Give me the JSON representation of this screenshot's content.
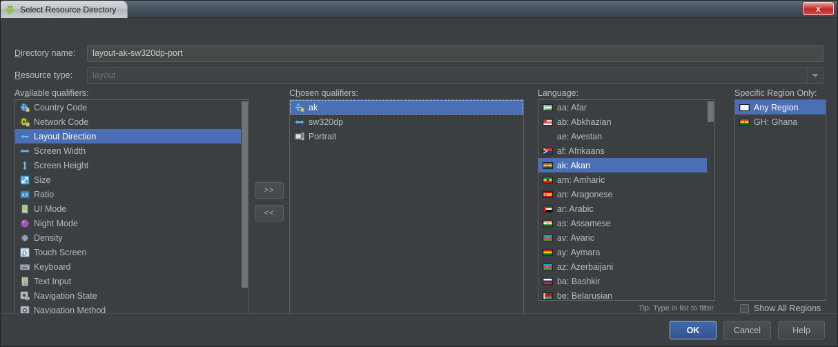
{
  "window": {
    "title": "Select Resource Directory",
    "app_icon": "android-robot-icon",
    "close_label": "x"
  },
  "form": {
    "directory_name": {
      "label": "Directory name:",
      "label_mnemonic": "D",
      "value": "layout-ak-sw320dp-port"
    },
    "resource_type": {
      "label": "Resource type:",
      "label_mnemonic": "R",
      "value": "layout",
      "disabled": true
    }
  },
  "available_qualifiers": {
    "label": "Available qualifiers:",
    "label_mnemonic": "a",
    "items": [
      {
        "label": "Country Code",
        "icon": "globe-icon",
        "selected": false
      },
      {
        "label": "Network Code",
        "icon": "network-icon",
        "selected": false
      },
      {
        "label": "Layout Direction",
        "icon": "arrow-left-icon",
        "selected": true
      },
      {
        "label": "Screen Width",
        "icon": "arrow-horizontal-icon",
        "selected": false
      },
      {
        "label": "Screen Height",
        "icon": "arrow-vertical-icon",
        "selected": false
      },
      {
        "label": "Size",
        "icon": "diagonal-arrow-icon",
        "selected": false
      },
      {
        "label": "Ratio",
        "icon": "ratio-icon",
        "selected": false
      },
      {
        "label": "UI Mode",
        "icon": "ui-mode-icon",
        "selected": false
      },
      {
        "label": "Night Mode",
        "icon": "moon-icon",
        "selected": false
      },
      {
        "label": "Density",
        "icon": "density-icon",
        "selected": false
      },
      {
        "label": "Touch Screen",
        "icon": "hand-pointer-icon",
        "selected": false
      },
      {
        "label": "Keyboard",
        "icon": "keyboard-icon",
        "selected": false
      },
      {
        "label": "Text Input",
        "icon": "text-input-icon",
        "selected": false
      },
      {
        "label": "Navigation State",
        "icon": "navigation-state-icon",
        "selected": false
      },
      {
        "label": "Navigation Method",
        "icon": "navigation-method-icon",
        "selected": false
      }
    ]
  },
  "transfer": {
    "add_label": ">>",
    "remove_label": "<<"
  },
  "chosen_qualifiers": {
    "label": "Chosen qualifiers:",
    "label_mnemonic": "h",
    "items": [
      {
        "label": "ak",
        "icon": "globe-icon",
        "selected": true
      },
      {
        "label": "sw320dp",
        "icon": "arrow-horizontal-icon",
        "selected": false
      },
      {
        "label": "Portrait",
        "icon": "portrait-icon",
        "selected": false
      }
    ]
  },
  "language": {
    "label": "Language:",
    "tip": "Tip: Type in list to filter",
    "items": [
      {
        "label": "aa: Afar",
        "flag": "flag-afar",
        "selected": false
      },
      {
        "label": "ab: Abkhazian",
        "flag": "flag-abkhazia",
        "selected": false
      },
      {
        "label": "ae: Avestan",
        "flag": "flag-none",
        "selected": false
      },
      {
        "label": "af: Afrikaans",
        "flag": "flag-south-africa",
        "selected": false
      },
      {
        "label": "ak: Akan",
        "flag": "flag-ghana",
        "selected": true
      },
      {
        "label": "am: Amharic",
        "flag": "flag-ethiopia",
        "selected": false
      },
      {
        "label": "an: Aragonese",
        "flag": "flag-spain",
        "selected": false
      },
      {
        "label": "ar: Arabic",
        "flag": "flag-uae",
        "selected": false
      },
      {
        "label": "as: Assamese",
        "flag": "flag-india",
        "selected": false
      },
      {
        "label": "av: Avaric",
        "flag": "flag-azerbaijan",
        "selected": false
      },
      {
        "label": "ay: Aymara",
        "flag": "flag-bolivia",
        "selected": false
      },
      {
        "label": "az: Azerbaijani",
        "flag": "flag-azerbaijan",
        "selected": false
      },
      {
        "label": "ba: Bashkir",
        "flag": "flag-russia",
        "selected": false
      },
      {
        "label": "be: Belarusian",
        "flag": "flag-belarus",
        "selected": false
      }
    ]
  },
  "region": {
    "label": "Specific Region Only:",
    "items": [
      {
        "label": "Any Region",
        "flag": "flag-blank",
        "selected": true
      },
      {
        "label": "GH: Ghana",
        "flag": "flag-ghana",
        "selected": false
      }
    ],
    "show_all": {
      "label": "Show All Regions",
      "checked": false
    }
  },
  "footer": {
    "ok": "OK",
    "cancel": "Cancel",
    "help": "Help"
  },
  "colors": {
    "selection": "#4a6fb5",
    "dialog_bg": "#3c3f41",
    "text": "#b7bbbd",
    "primary_button": "#3f6bae"
  }
}
